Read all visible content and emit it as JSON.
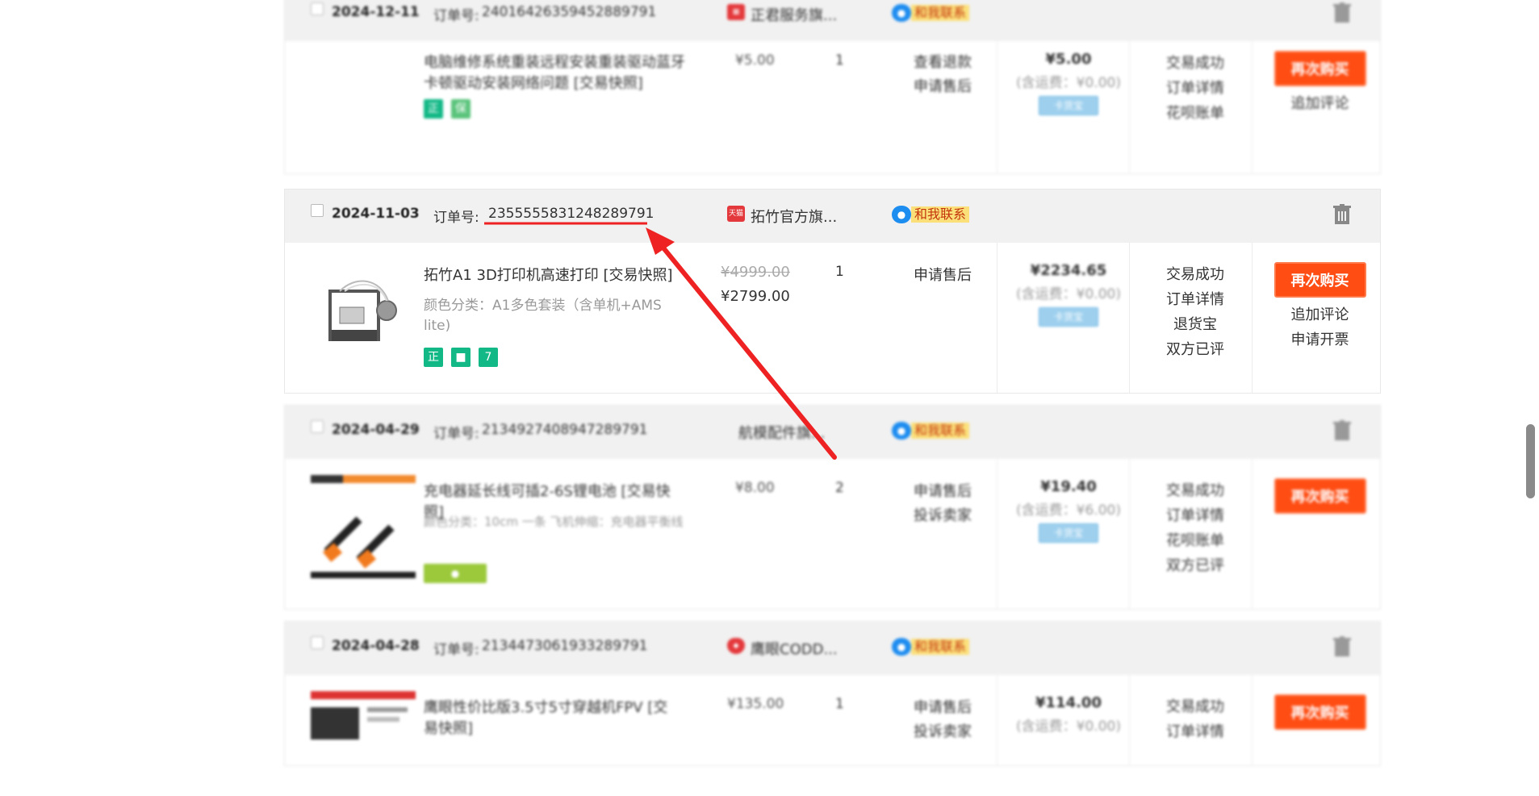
{
  "labels": {
    "order_no": "订单号:",
    "contact": "和我联系",
    "rebuy": "再次购买",
    "tag_rider": "卡货宝"
  },
  "orders": [
    {
      "date": "2024-12-11",
      "order_no": "24016426359452889791",
      "shop": "正君服务旗...",
      "title": "电脑维修系统重装远程安装重装驱动蓝牙卡顿驱动安装网络问题 [交易快照]",
      "unit_price": "¥5.00",
      "qty": "1",
      "after_sale": [
        "查看退款",
        "申请售后"
      ],
      "total": "¥5.00",
      "shipping": "(含运费：¥0.00)",
      "status": [
        "交易成功",
        "订单详情",
        "花呗账单"
      ],
      "ops": [
        "追加评论"
      ]
    },
    {
      "date": "2024-11-03",
      "order_no": "2355555831248289791",
      "shop": "拓竹官方旗...",
      "title": "拓竹A1 3D打印机高速打印 [交易快照]",
      "sku": "颜色分类：A1多色套装（含单机+AMS lite)",
      "price_old": "¥4999.00",
      "price_new": "¥2799.00",
      "qty": "1",
      "after_sale": [
        "申请售后"
      ],
      "total": "¥2234.65",
      "shipping": "(含运费：¥0.00)",
      "status": [
        "交易成功",
        "订单详情",
        "退货宝",
        "双方已评"
      ],
      "ops": [
        "追加评论",
        "申请开票"
      ]
    },
    {
      "date": "2024-04-29",
      "order_no": "2134927408947289791",
      "shop": "航模配件旗...",
      "title": "充电器延长线可插2-6S锂电池 [交易快照]",
      "sku": "颜色分类：10cm 一条 飞机伸缩：充电器平衡线",
      "unit_price": "¥8.00",
      "qty": "2",
      "after_sale": [
        "申请售后",
        "投诉卖家"
      ],
      "total": "¥19.40",
      "shipping": "(含运费：¥6.00)",
      "status": [
        "交易成功",
        "订单详情",
        "花呗账单",
        "双方已评"
      ],
      "ops": []
    },
    {
      "date": "2024-04-28",
      "order_no": "2134473061933289791",
      "shop": "鹰眼CODD...",
      "title": "鹰眼性价比版3.5寸5寸穿越机FPV [交易快照]",
      "unit_price": "¥135.00",
      "qty": "1",
      "after_sale": [
        "申请售后",
        "投诉卖家"
      ],
      "total": "¥114.00",
      "shipping": "(含运费：¥0.00)",
      "status": [
        "交易成功",
        "订单详情"
      ],
      "ops": []
    }
  ],
  "colors": {
    "accent": "#ff4d13",
    "annotation": "#ee2222",
    "contact_bg": "#fbe07a"
  }
}
